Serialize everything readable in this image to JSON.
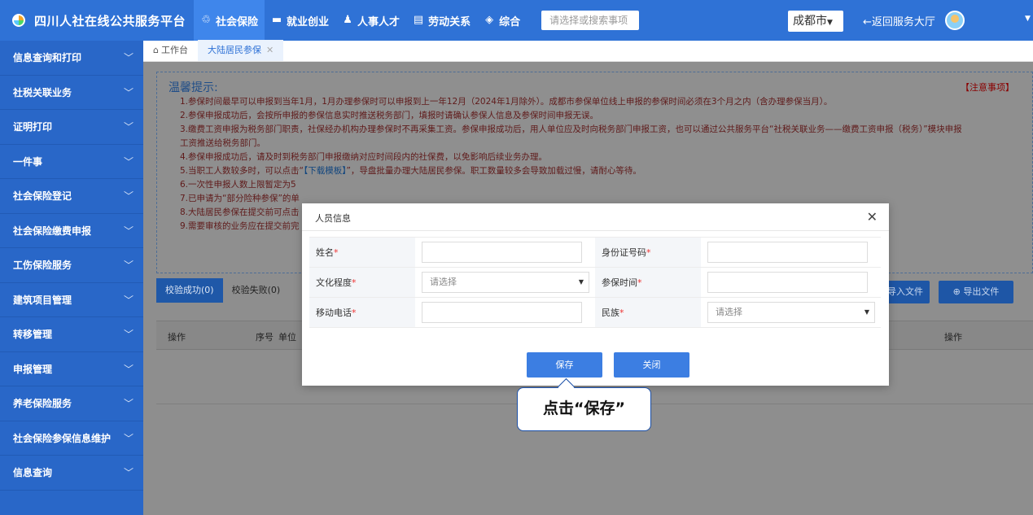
{
  "header": {
    "brand": "四川人社在线公共服务平台",
    "nav": [
      {
        "label": "社会保险",
        "icon": "social-insurance-icon"
      },
      {
        "label": "就业创业",
        "icon": "briefcase-icon"
      },
      {
        "label": "人事人才",
        "icon": "people-icon"
      },
      {
        "label": "劳动关系",
        "icon": "document-icon"
      },
      {
        "label": "综合",
        "icon": "layers-icon"
      }
    ],
    "search_placeholder": "请选择或搜索事项",
    "city": "成都市",
    "back": "←返回服务大厅"
  },
  "sidebar": {
    "items": [
      {
        "label": "信息查询和打印"
      },
      {
        "label": "社税关联业务"
      },
      {
        "label": "证明打印"
      },
      {
        "label": "一件事"
      },
      {
        "label": "社会保险登记"
      },
      {
        "label": "社会保险缴费申报"
      },
      {
        "label": "工伤保险服务"
      },
      {
        "label": "建筑项目管理"
      },
      {
        "label": "转移管理"
      },
      {
        "label": "申报管理"
      },
      {
        "label": "养老保险服务"
      },
      {
        "label": "社会保险参保信息维护"
      },
      {
        "label": "信息查询"
      }
    ]
  },
  "tabs": {
    "home": "工作台",
    "current": "大陆居民参保"
  },
  "notice": {
    "title": "温馨提示:",
    "attention": "【注意事项】",
    "lines": [
      "1.参保时间最早可以申报到当年1月，1月办理参保时可以申报到上一年12月（2024年1月除外）。成都市参保单位线上申报的参保时间必须在3个月之内（含办理参保当月）。",
      "2.参保申报成功后，会按所申报的参保信息实时推送税务部门，填报时请确认参保人信息及参保时间申报无误。",
      "3.缴费工资申报为税务部门职责，社保经办机构办理参保时不再采集工资。参保申报成功后，用人单位应及时向税务部门申报工资，也可以通过公共服务平台“社税关联业务——缴费工资申报（税务）”模块申报",
      "工资推送给税务部门。",
      "4.参保申报成功后，请及时到税务部门申报缴纳对应时间段内的社保费，以免影响后续业务办理。",
      "5.当职工人数较多时，可以点击“",
      "6.一次性申报人数上限暂定为5",
      "7.已申请为“部分险种参保”的单",
      "8.大陆居民参保在提交前可点击",
      "9.需要审核的业务应在提交前完"
    ],
    "download_link": "【下载模板】",
    "line5_tail": "”，导盘批量办理大陆居民参保。职工数量较多会导致加载过慢，请耐心等待。"
  },
  "results": {
    "tab_success": "校验成功(0)",
    "tab_fail": "校验失败(0)",
    "import_label": "导入文件",
    "export_label": "⊕ 导出文件",
    "columns": [
      "操作",
      "序号",
      "单位",
      "操作"
    ]
  },
  "modal": {
    "title": "人员信息",
    "fields": [
      {
        "label": "姓名",
        "value": ""
      },
      {
        "label": "身份证号码",
        "value": ""
      },
      {
        "label": "文化程度",
        "placeholder": "请选择"
      },
      {
        "label": "参保时间",
        "value": ""
      },
      {
        "label": "移动电话",
        "value": ""
      },
      {
        "label": "民族",
        "placeholder": "请选择"
      }
    ],
    "required_mark": "*",
    "save": "保存",
    "close": "关闭"
  },
  "tooltip": "点击“保存”"
}
